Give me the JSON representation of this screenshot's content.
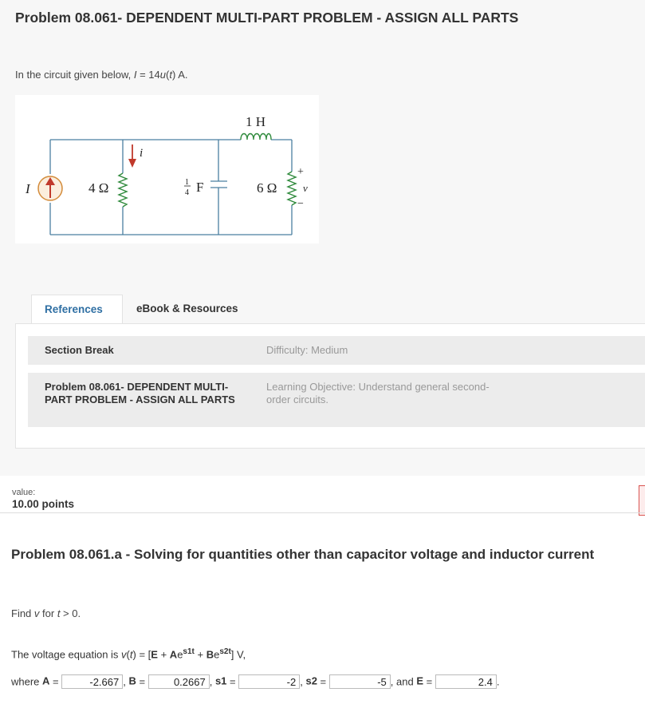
{
  "title": "Problem 08.061- DEPENDENT MULTI-PART PROBLEM - ASSIGN ALL PARTS",
  "intro": {
    "prefix": "In the circuit given below, ",
    "var": "I",
    "mid": " = 14",
    "func": "u",
    "paren_open": "(",
    "t": "t",
    "paren_close": ")",
    "suffix": " A."
  },
  "circuit": {
    "source_label": "I",
    "r1_label": "4 Ω",
    "current_label": "i",
    "cap_frac_num": "1",
    "cap_frac_den": "4",
    "cap_unit": "F",
    "inductor_label": "1 H",
    "r2_label": "6 Ω",
    "voltage_label": "v",
    "plus": "+",
    "minus": "−"
  },
  "tabs": [
    {
      "label": "References",
      "active": true
    },
    {
      "label": "eBook & Resources",
      "active": false
    }
  ],
  "rows": [
    {
      "label": "Section Break",
      "meta": "Difficulty: Medium"
    },
    {
      "label": "Problem 08.061- DEPENDENT MULTI-PART PROBLEM - ASSIGN ALL PARTS",
      "meta": "Learning Objective: Understand general second-order circuits."
    }
  ],
  "value": {
    "label": "value:",
    "points": "10.00 points"
  },
  "part": {
    "title": "Problem 08.061.a - Solving for quantities other than capacitor voltage and inductor current",
    "find_prefix": "Find ",
    "find_var": "v",
    "find_mid": " for ",
    "find_t": "t",
    "find_suffix": " > 0."
  },
  "equation": {
    "prefix": "The voltage equation is ",
    "v": "v",
    "t_paren_open": "(",
    "t": "t",
    "t_paren_close": ")",
    "eq": " = [",
    "E": "E",
    "plus1": " + ",
    "A": "A",
    "e1": "e",
    "s1t": "s1t",
    "plus2": " + ",
    "B": "B",
    "e2": "e",
    "s2t": "s2t",
    "suffix": "] V,"
  },
  "answers": {
    "where": "where ",
    "A_label": "A",
    "A_value": "-2.667",
    "B_label": "B",
    "B_value": "0.2667",
    "s1_label": "s1",
    "s1_value": "-2",
    "s2_label": "s2",
    "s2_value": "-5",
    "and": "and ",
    "E_label": "E",
    "E_value": "2.4",
    "equals": " = ",
    "comma": ", ",
    "period": "."
  },
  "colors": {
    "wire": "#4a7fa0",
    "resistor": "#2f8a3c",
    "source": "#c0392b",
    "accent": "#2f6fa3"
  }
}
